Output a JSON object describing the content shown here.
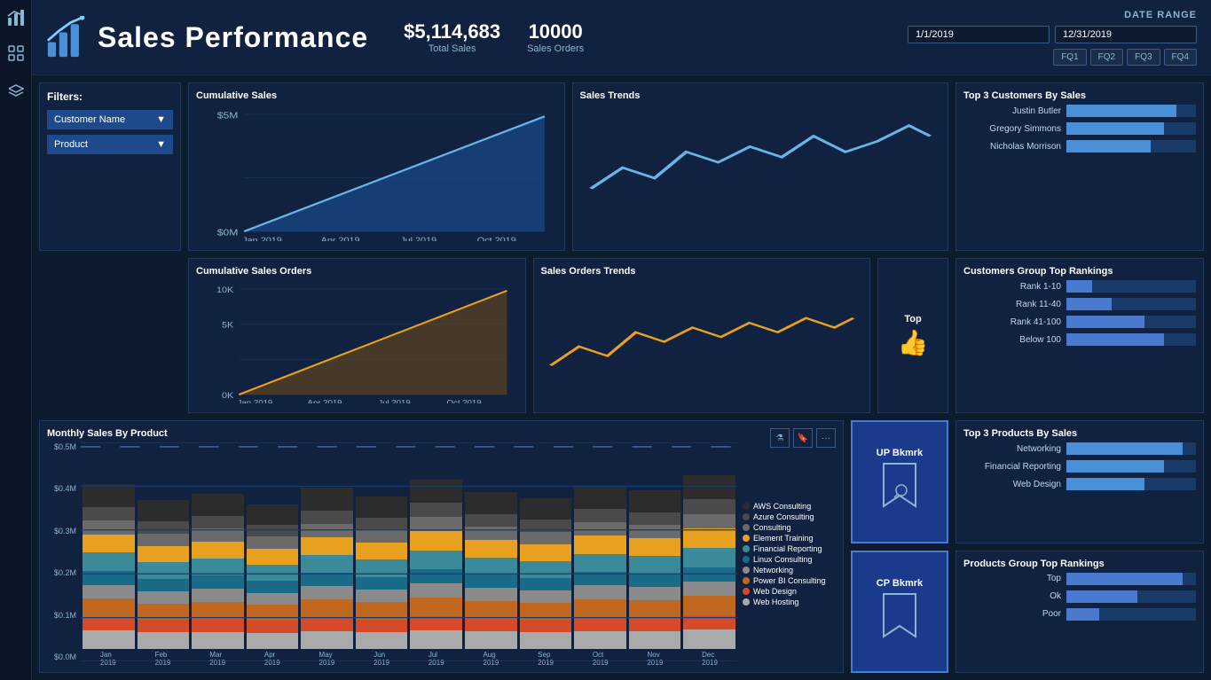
{
  "sidebar": {
    "icons": [
      "chart-icon",
      "grid-icon",
      "layers-icon"
    ]
  },
  "header": {
    "title": "Sales Performance",
    "total_sales": "$5,114,683",
    "total_sales_label": "Total Sales",
    "sales_orders": "10000",
    "sales_orders_label": "Sales Orders",
    "date_range_label": "DATE RANGE",
    "date_start": "1/1/2019",
    "date_end": "12/31/2019",
    "quarters": [
      "FQ1",
      "FQ2",
      "FQ3",
      "FQ4"
    ]
  },
  "filters": {
    "title": "Filters:",
    "filter1": "Customer Name",
    "filter2": "Product"
  },
  "cumulative_sales": {
    "title": "Cumulative Sales",
    "y_labels": [
      "$5M",
      "$0M"
    ],
    "x_labels": [
      "Jan 2019",
      "Apr 2019",
      "Jul 2019",
      "Oct 2019"
    ]
  },
  "sales_trends": {
    "title": "Sales Trends"
  },
  "top_customers": {
    "title": "Top 3 Customers By Sales",
    "customers": [
      {
        "name": "Justin Butler",
        "pct": 85
      },
      {
        "name": "Gregory Simmons",
        "pct": 75
      },
      {
        "name": "Nicholas Morrison",
        "pct": 65
      }
    ]
  },
  "cumulative_orders": {
    "title": "Cumulative Sales Orders",
    "y_labels": [
      "10K",
      "5K",
      "0K"
    ],
    "x_labels": [
      "Jan 2019",
      "Apr 2019",
      "Jul 2019",
      "Oct 2019"
    ]
  },
  "sales_orders_trends": {
    "title": "Sales Orders Trends"
  },
  "thumb": {
    "label": "Top"
  },
  "customers_group": {
    "title": "Customers Group Top Rankings",
    "ranks": [
      {
        "label": "Rank 1-10",
        "pct": 20
      },
      {
        "label": "Rank 11-40",
        "pct": 35
      },
      {
        "label": "Rank 41-100",
        "pct": 60
      },
      {
        "label": "Below 100",
        "pct": 75
      }
    ]
  },
  "monthly_chart": {
    "title": "Monthly Sales By Product",
    "y_labels": [
      "$0.5M",
      "$0.4M",
      "$0.3M",
      "$0.2M",
      "$0.1M",
      "$0.0M"
    ],
    "x_labels": [
      "Jan\n2019",
      "Feb\n2019",
      "Mar\n2019",
      "Apr\n2019",
      "May\n2019",
      "Jun\n2019",
      "Jul\n2019",
      "Aug\n2019",
      "Sep\n2019",
      "Oct\n2019",
      "Nov\n2019",
      "Dec\n2019"
    ],
    "toolbar_icons": [
      "filter-icon",
      "bookmark-icon",
      "more-icon"
    ],
    "legend": [
      {
        "label": "AWS Consulting",
        "color": "#2c2c2c"
      },
      {
        "label": "Azure Consulting",
        "color": "#4a4a4a"
      },
      {
        "label": "Consulting",
        "color": "#6a6a6a"
      },
      {
        "label": "Element Training",
        "color": "#e8a020"
      },
      {
        "label": "Financial Reporting",
        "color": "#3a8a9a"
      },
      {
        "label": "Linux Consulting",
        "color": "#1a6a8a"
      },
      {
        "label": "Networking",
        "color": "#8a8a8a"
      },
      {
        "label": "Power BI Consulting",
        "color": "#c06820"
      },
      {
        "label": "Web Design",
        "color": "#d44a2a"
      },
      {
        "label": "Web Hosting",
        "color": "#aaaaaa"
      }
    ]
  },
  "bookmarks": {
    "up_label": "UP Bkmrk",
    "cp_label": "CP Bkmrk"
  },
  "top_products": {
    "title": "Top 3 Products By Sales",
    "products": [
      {
        "name": "Networking",
        "pct": 90
      },
      {
        "name": "Financial Reporting",
        "pct": 75
      },
      {
        "name": "Web Design",
        "pct": 60
      }
    ]
  },
  "products_group": {
    "title": "Products Group Top Rankings",
    "ranks": [
      {
        "label": "Top",
        "pct": 90
      },
      {
        "label": "Ok",
        "pct": 55
      },
      {
        "label": "Poor",
        "pct": 25
      }
    ]
  }
}
